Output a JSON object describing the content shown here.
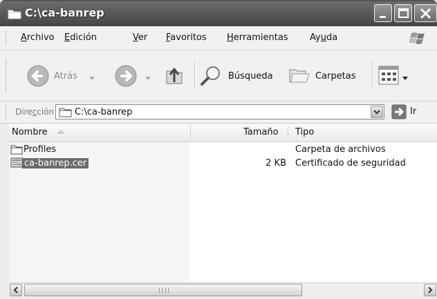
{
  "window": {
    "title": "C:\\ca-banrep"
  },
  "title_buttons": [
    "minimize",
    "maximize",
    "close"
  ],
  "menu": {
    "items": [
      {
        "pre": "",
        "key": "A",
        "post": "rchivo"
      },
      {
        "pre": "",
        "key": "E",
        "post": "dición"
      },
      {
        "pre": "",
        "key": "V",
        "post": "er"
      },
      {
        "pre": "",
        "key": "F",
        "post": "avoritos"
      },
      {
        "pre": "",
        "key": "H",
        "post": "erramientas"
      },
      {
        "pre": "Ay",
        "key": "u",
        "post": "da"
      }
    ]
  },
  "toolbar": {
    "back_label": "Atrás",
    "search_label": "Búsqueda",
    "folders_label": "Carpetas"
  },
  "address": {
    "label_pre": "Dire",
    "label_key": "c",
    "label_post": "ción",
    "value": "C:\\ca-banrep",
    "go_label": "Ir"
  },
  "list": {
    "columns": {
      "name": "Nombre",
      "size": "Tamaño",
      "type": "Tipo"
    },
    "rows": [
      {
        "name": "Profiles",
        "size": "",
        "type": "Carpeta de archivos",
        "icon": "folder-icon",
        "selected": false
      },
      {
        "name": "ca-banrep.cer",
        "size": "2 KB",
        "type": "Certificado de seguridad",
        "icon": "certificate-icon",
        "selected": true
      }
    ]
  },
  "scrollbar": {
    "position_fraction": 0.0
  }
}
